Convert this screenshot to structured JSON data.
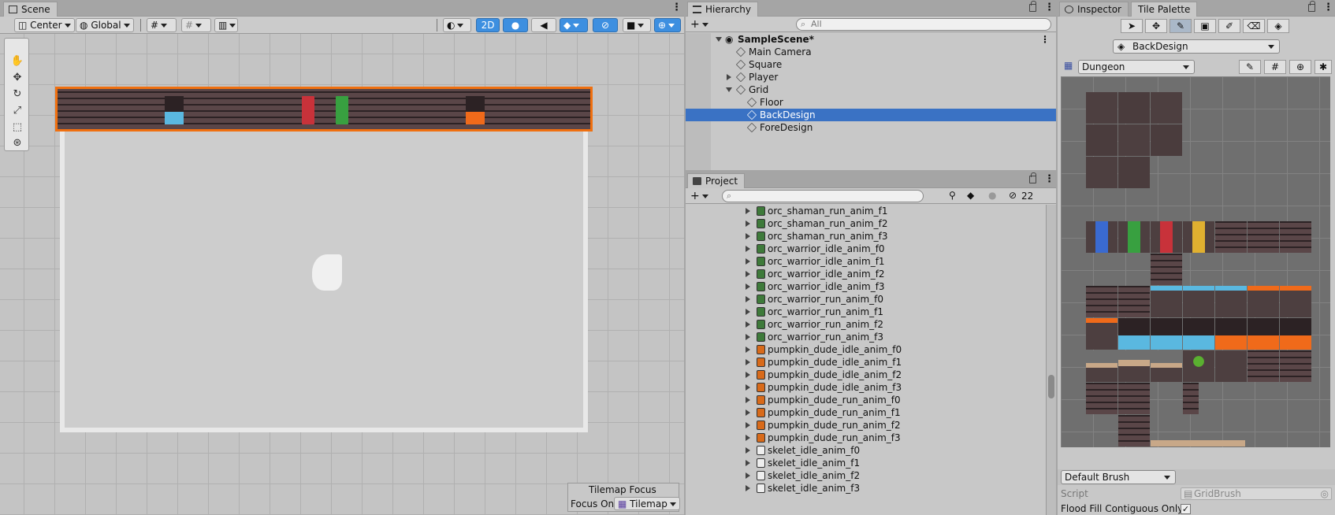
{
  "scene": {
    "tab": "Scene",
    "toolbar": {
      "pivot": "Center",
      "space": "Global",
      "mode_2d": "2D"
    },
    "tilemap_focus": {
      "title": "Tilemap Focus",
      "label": "Focus On",
      "value": "Tilemap"
    }
  },
  "hierarchy": {
    "tab": "Hierarchy",
    "search_placeholder": "All",
    "items": [
      {
        "label": "SampleScene*"
      },
      {
        "label": "Main Camera"
      },
      {
        "label": "Square"
      },
      {
        "label": "Player"
      },
      {
        "label": "Grid"
      },
      {
        "label": "Floor"
      },
      {
        "label": "BackDesign"
      },
      {
        "label": "ForeDesign"
      }
    ]
  },
  "project": {
    "tab": "Project",
    "hidden_count": "22",
    "items": [
      {
        "label": "orc_shaman_run_anim_f1",
        "color": "#3e7a3a"
      },
      {
        "label": "orc_shaman_run_anim_f2",
        "color": "#3e7a3a"
      },
      {
        "label": "orc_shaman_run_anim_f3",
        "color": "#3e7a3a"
      },
      {
        "label": "orc_warrior_idle_anim_f0",
        "color": "#3e7a3a"
      },
      {
        "label": "orc_warrior_idle_anim_f1",
        "color": "#3e7a3a"
      },
      {
        "label": "orc_warrior_idle_anim_f2",
        "color": "#3e7a3a"
      },
      {
        "label": "orc_warrior_idle_anim_f3",
        "color": "#3e7a3a"
      },
      {
        "label": "orc_warrior_run_anim_f0",
        "color": "#3e7a3a"
      },
      {
        "label": "orc_warrior_run_anim_f1",
        "color": "#3e7a3a"
      },
      {
        "label": "orc_warrior_run_anim_f2",
        "color": "#3e7a3a"
      },
      {
        "label": "orc_warrior_run_anim_f3",
        "color": "#3e7a3a"
      },
      {
        "label": "pumpkin_dude_idle_anim_f0",
        "color": "#d86a1a"
      },
      {
        "label": "pumpkin_dude_idle_anim_f1",
        "color": "#d86a1a"
      },
      {
        "label": "pumpkin_dude_idle_anim_f2",
        "color": "#d86a1a"
      },
      {
        "label": "pumpkin_dude_idle_anim_f3",
        "color": "#d86a1a"
      },
      {
        "label": "pumpkin_dude_run_anim_f0",
        "color": "#d86a1a"
      },
      {
        "label": "pumpkin_dude_run_anim_f1",
        "color": "#d86a1a"
      },
      {
        "label": "pumpkin_dude_run_anim_f2",
        "color": "#d86a1a"
      },
      {
        "label": "pumpkin_dude_run_anim_f3",
        "color": "#d86a1a"
      },
      {
        "label": "skelet_idle_anim_f0",
        "color": "#eeeeee"
      },
      {
        "label": "skelet_idle_anim_f1",
        "color": "#eeeeee"
      },
      {
        "label": "skelet_idle_anim_f2",
        "color": "#eeeeee"
      },
      {
        "label": "skelet_idle_anim_f3",
        "color": "#eeeeee"
      }
    ]
  },
  "right_panel": {
    "tabs": [
      "Inspector",
      "Tile Palette"
    ],
    "active_tilemap": "BackDesign",
    "palette": "Dungeon",
    "brush": "Default Brush",
    "script_label": "Script",
    "script_value": "GridBrush",
    "flood_fill_label": "Flood Fill Contiguous Only",
    "flood_fill_checked": true
  },
  "colors": {
    "selection": "#3a72c4",
    "tilemap_outline": "#f07010",
    "toolbar_active": "#3d8fe0"
  }
}
